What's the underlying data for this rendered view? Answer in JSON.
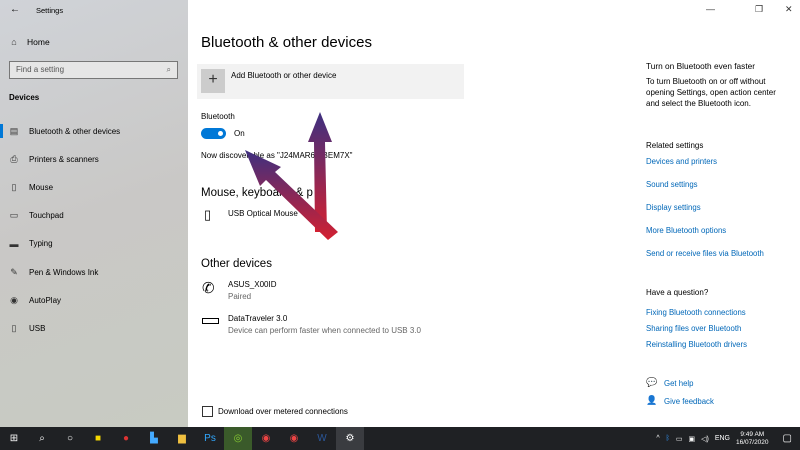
{
  "window": {
    "title": "Settings"
  },
  "sidebar": {
    "home": "Home",
    "search_placeholder": "Find a setting",
    "section": "Devices",
    "items": [
      {
        "label": "Bluetooth & other devices",
        "icon": "bluetooth-devices-icon"
      },
      {
        "label": "Printers & scanners",
        "icon": "printer-icon"
      },
      {
        "label": "Mouse",
        "icon": "mouse-icon"
      },
      {
        "label": "Touchpad",
        "icon": "touchpad-icon"
      },
      {
        "label": "Typing",
        "icon": "keyboard-icon"
      },
      {
        "label": "Pen & Windows Ink",
        "icon": "pen-icon"
      },
      {
        "label": "AutoPlay",
        "icon": "autoplay-icon"
      },
      {
        "label": "USB",
        "icon": "usb-icon"
      }
    ]
  },
  "main": {
    "title": "Bluetooth & other devices",
    "add_device": "Add Bluetooth or other device",
    "bluetooth_label": "Bluetooth",
    "toggle_state": "On",
    "discoverable": "Now discoverable as \"J24MAR6  XBEM7X\"",
    "mouse_section": "Mouse, keyboard, & p",
    "mouse_device": "USB Optical Mouse",
    "other_section": "Other devices",
    "devices": [
      {
        "name": "ASUS_X00ID",
        "status": "Paired"
      },
      {
        "name": "DataTraveler 3.0",
        "status": "Device can perform faster when connected to USB 3.0"
      }
    ],
    "metered": "Download over metered connections"
  },
  "right": {
    "tip_title": "Turn on Bluetooth even faster",
    "tip_text": [
      "To turn Bluetooth on or off without",
      "opening Settings, open action center",
      "and select the Bluetooth icon."
    ],
    "related_title": "Related settings",
    "related": [
      "Devices and printers",
      "Sound settings",
      "Display settings",
      "More Bluetooth options",
      "Send or receive files via Bluetooth"
    ],
    "question_title": "Have a question?",
    "help_links": [
      "Fixing Bluetooth connections",
      "Sharing files over Bluetooth",
      "Reinstalling Bluetooth drivers"
    ],
    "get_help": "Get help",
    "feedback": "Give feedback"
  },
  "taskbar": {
    "lang": "ENG",
    "time": "9:49 AM",
    "date": "16/07/2020"
  },
  "colors": {
    "accent": "#0078d7",
    "link": "#0067b8",
    "arrow_top": "#3d3080",
    "arrow_bottom": "#d42030"
  }
}
